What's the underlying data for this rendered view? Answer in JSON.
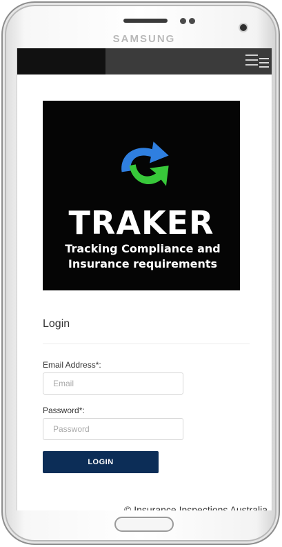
{
  "device": {
    "brand": "SAMSUNG"
  },
  "logo": {
    "title": "TRAKER",
    "tagline_line1": "Tracking Compliance and",
    "tagline_line2": "Insurance requirements"
  },
  "login": {
    "heading": "Login",
    "email_label": "Email Address*:",
    "email_placeholder": "Email",
    "password_label": "Password*:",
    "password_placeholder": "Password",
    "button_label": "LOGIN"
  },
  "footer": {
    "copyright": "© Insurance Inspections Australia"
  },
  "colors": {
    "button": "#0c2d57",
    "logo_blue": "#2f7fe0",
    "logo_green": "#38c83a",
    "topbar": "#3b3b3b"
  }
}
